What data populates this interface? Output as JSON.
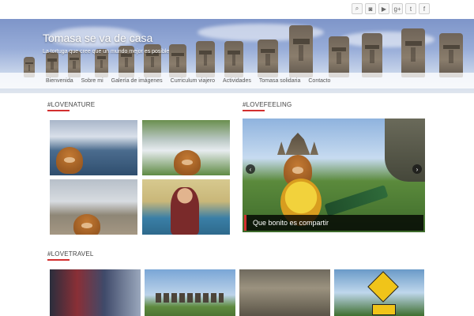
{
  "site": {
    "title": "Tomasa se va de casa",
    "tagline": "La tortuga que cree que un mundo mejor es posible"
  },
  "social": [
    {
      "icon": "search-icon",
      "glyph": "⌕"
    },
    {
      "icon": "instagram-icon",
      "glyph": "◙"
    },
    {
      "icon": "youtube-icon",
      "glyph": "▶"
    },
    {
      "icon": "google-plus-icon",
      "glyph": "g+"
    },
    {
      "icon": "twitter-icon",
      "glyph": "t"
    },
    {
      "icon": "facebook-icon",
      "glyph": "f"
    }
  ],
  "nav": {
    "items": [
      {
        "label": "Bienvenida"
      },
      {
        "label": "Sobre mi"
      },
      {
        "label": "Galería de imágenes"
      },
      {
        "label": "Curriculum viajero"
      },
      {
        "label": "Actividades"
      },
      {
        "label": "Tomasa solidaria"
      },
      {
        "label": "Contacto"
      }
    ]
  },
  "sections": {
    "lovenature": "#LOVENATURE",
    "lovefeeling": "#LOVEFEELING",
    "lovetravel": "#LOVETRAVEL"
  },
  "slider": {
    "caption": "Que bonito es compartir",
    "prev_glyph": "‹",
    "next_glyph": "›"
  },
  "colors": {
    "accent": "#d32f2f",
    "nav_text": "#555555",
    "caption_bg": "#000000"
  }
}
